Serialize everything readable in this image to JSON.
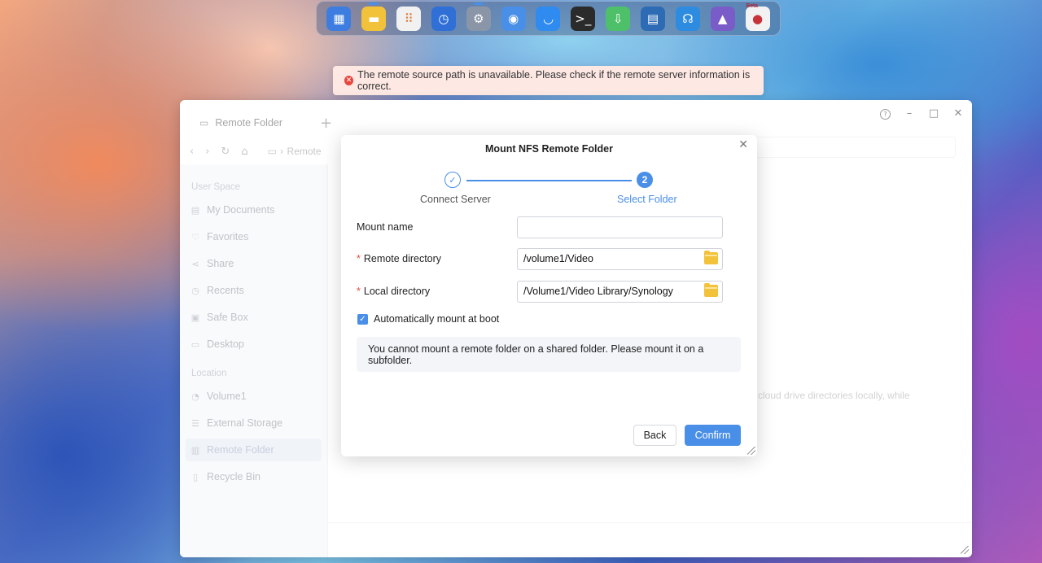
{
  "dock": {
    "apps": [
      {
        "name": "dashboard-app-icon",
        "color": "#3d7de0",
        "glyph": "▦",
        "running": false
      },
      {
        "name": "notes-app-icon",
        "color": "#f3c23b",
        "glyph": "▬",
        "running": true
      },
      {
        "name": "app-center-icon",
        "color": "#f1f1f1",
        "glyph": "⠿",
        "running": false
      },
      {
        "name": "backup-app-icon",
        "color": "#2f6fd6",
        "glyph": "◷",
        "running": false
      },
      {
        "name": "settings-app-icon",
        "color": "#8a96a8",
        "glyph": "⚙",
        "running": true
      },
      {
        "name": "storage-app-icon",
        "color": "#4a8fe7",
        "glyph": "◉",
        "running": false
      },
      {
        "name": "store-app-icon",
        "color": "#2f8bf0",
        "glyph": "◡",
        "running": false
      },
      {
        "name": "terminal-app-icon",
        "color": "#2b2b2b",
        "glyph": ">_",
        "running": false
      },
      {
        "name": "download-app-icon",
        "color": "#4ec06a",
        "glyph": "⇩",
        "running": false
      },
      {
        "name": "docker-app-icon",
        "color": "#2d6bb5",
        "glyph": "▤",
        "running": false
      },
      {
        "name": "support-app-icon",
        "color": "#2d8be0",
        "glyph": "☊",
        "running": false
      },
      {
        "name": "media-app-icon",
        "color": "#7a5cc8",
        "glyph": "▲",
        "running": false
      },
      {
        "name": "beta-app-icon",
        "color": "#f2f2f2",
        "glyph": "●",
        "running": false,
        "badge": "Beta"
      }
    ]
  },
  "toast": {
    "message": "The remote source path is unavailable. Please check if the remote server information is correct."
  },
  "window": {
    "tab_label": "Remote Folder",
    "path_label": "Remote",
    "sidebar": {
      "user_space_heading": "User Space",
      "user_items": [
        {
          "label": "My Documents",
          "icon": "document-icon",
          "glyph": "▤"
        },
        {
          "label": "Favorites",
          "icon": "heart-icon",
          "glyph": "♡"
        },
        {
          "label": "Share",
          "icon": "share-icon",
          "glyph": "⋖"
        },
        {
          "label": "Recents",
          "icon": "clock-icon",
          "glyph": "◷"
        },
        {
          "label": "Safe Box",
          "icon": "safe-icon",
          "glyph": "▣"
        },
        {
          "label": "Desktop",
          "icon": "monitor-icon",
          "glyph": "▭"
        }
      ],
      "location_heading": "Location",
      "location_items": [
        {
          "label": "Volume1",
          "icon": "disk-icon",
          "glyph": "◔",
          "active": false
        },
        {
          "label": "External Storage",
          "icon": "storage-icon",
          "glyph": "☰",
          "active": false
        },
        {
          "label": "Remote Folder",
          "icon": "remote-folder-icon",
          "glyph": "▥",
          "active": true
        },
        {
          "label": "Recycle Bin",
          "icon": "trash-icon",
          "glyph": "▯",
          "active": false
        }
      ]
    },
    "background_text": "cloud drive directories locally, while"
  },
  "modal": {
    "title": "Mount NFS Remote Folder",
    "steps": [
      {
        "label": "Connect Server",
        "state": "done"
      },
      {
        "number": "2",
        "label": "Select Folder",
        "state": "current"
      }
    ],
    "fields": {
      "mount_name_label": "Mount name",
      "mount_name_value": "",
      "remote_dir_label": "Remote directory",
      "remote_dir_value": "/volume1/Video",
      "local_dir_label": "Local directory",
      "local_dir_value": "/Volume1/Video Library/Synology",
      "required_mark": "*"
    },
    "auto_mount_label": "Automatically mount at boot",
    "auto_mount_checked": true,
    "note": "You cannot mount a remote folder on a shared folder. Please mount it on a subfolder.",
    "back_label": "Back",
    "confirm_label": "Confirm"
  },
  "colors": {
    "accent": "#4a8fe7",
    "error": "#e5473e",
    "toast_bg": "#fde8e4"
  }
}
